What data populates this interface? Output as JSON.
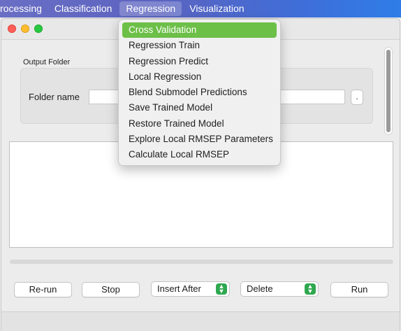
{
  "menubar": {
    "items": [
      {
        "label": "rocessing"
      },
      {
        "label": "Classification"
      },
      {
        "label": "Regression",
        "active": true
      },
      {
        "label": "Visualization"
      }
    ]
  },
  "window": {
    "output_group": {
      "title": "Output Folder",
      "folder_label": "Folder name",
      "folder_value": "",
      "browse_label": "."
    },
    "log_text": ""
  },
  "toolbar": {
    "rerun_label": "Re-run",
    "stop_label": "Stop",
    "insert_select": {
      "selected": "Insert After"
    },
    "delete_select": {
      "selected": "Delete"
    },
    "run_label": "Run"
  },
  "regression_menu": {
    "items": [
      {
        "label": "Cross Validation",
        "highlighted": true
      },
      {
        "label": "Regression Train"
      },
      {
        "label": "Regression Predict"
      },
      {
        "label": "Local Regression"
      },
      {
        "label": "Blend Submodel Predictions"
      },
      {
        "label": "Save Trained Model"
      },
      {
        "label": "Restore Trained Model"
      },
      {
        "label": "Explore Local RMSEP Parameters"
      },
      {
        "label": "Calculate Local RMSEP"
      }
    ]
  },
  "colors": {
    "highlight": "#6cbf47",
    "select_stepper": "#2fa84f",
    "menubar_start": "#6a6fc4",
    "menubar_end": "#2f7de8"
  }
}
